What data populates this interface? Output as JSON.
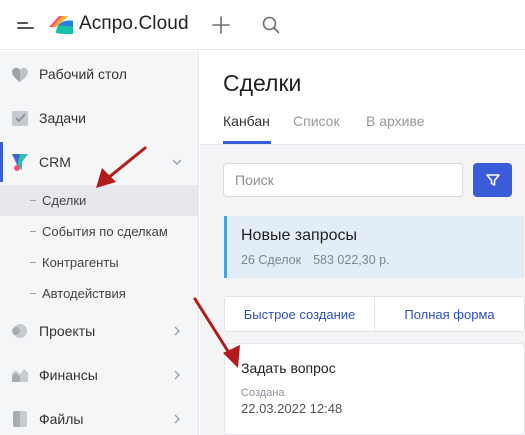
{
  "header": {
    "brand": "Аспро.Cloud"
  },
  "sidebar": {
    "items": [
      {
        "label": "Рабочий стол",
        "icon": "heart-icon"
      },
      {
        "label": "Задачи",
        "icon": "check-icon"
      },
      {
        "label": "CRM",
        "icon": "crm-funnel-icon",
        "expanded": true
      },
      {
        "label": "Проекты",
        "icon": "projects-icon"
      },
      {
        "label": "Финансы",
        "icon": "finance-icon"
      },
      {
        "label": "Файлы",
        "icon": "files-icon"
      }
    ],
    "crm_subitems": [
      {
        "label": "Сделки",
        "active": true
      },
      {
        "label": "События по сделкам"
      },
      {
        "label": "Контрагенты"
      },
      {
        "label": "Автодействия"
      }
    ]
  },
  "main": {
    "title": "Сделки",
    "tabs": [
      {
        "label": "Канбан",
        "active": true
      },
      {
        "label": "Список"
      },
      {
        "label": "В архиве"
      }
    ],
    "search": {
      "placeholder": "Поиск",
      "value": ""
    },
    "stage": {
      "title": "Новые запросы",
      "count": "26 Сделок",
      "amount": "583 022,30 р."
    },
    "create": {
      "quick": "Быстрое создание",
      "full": "Полная форма"
    },
    "deal": {
      "title": "Задать вопрос",
      "created_label": "Создана",
      "created_value": "22.03.2022 12:48"
    }
  },
  "colors": {
    "accent": "#3a5cd8",
    "stage_border": "#4aa3df",
    "stage_bg": "#e3edf7",
    "annotation": "#b31b1b"
  }
}
